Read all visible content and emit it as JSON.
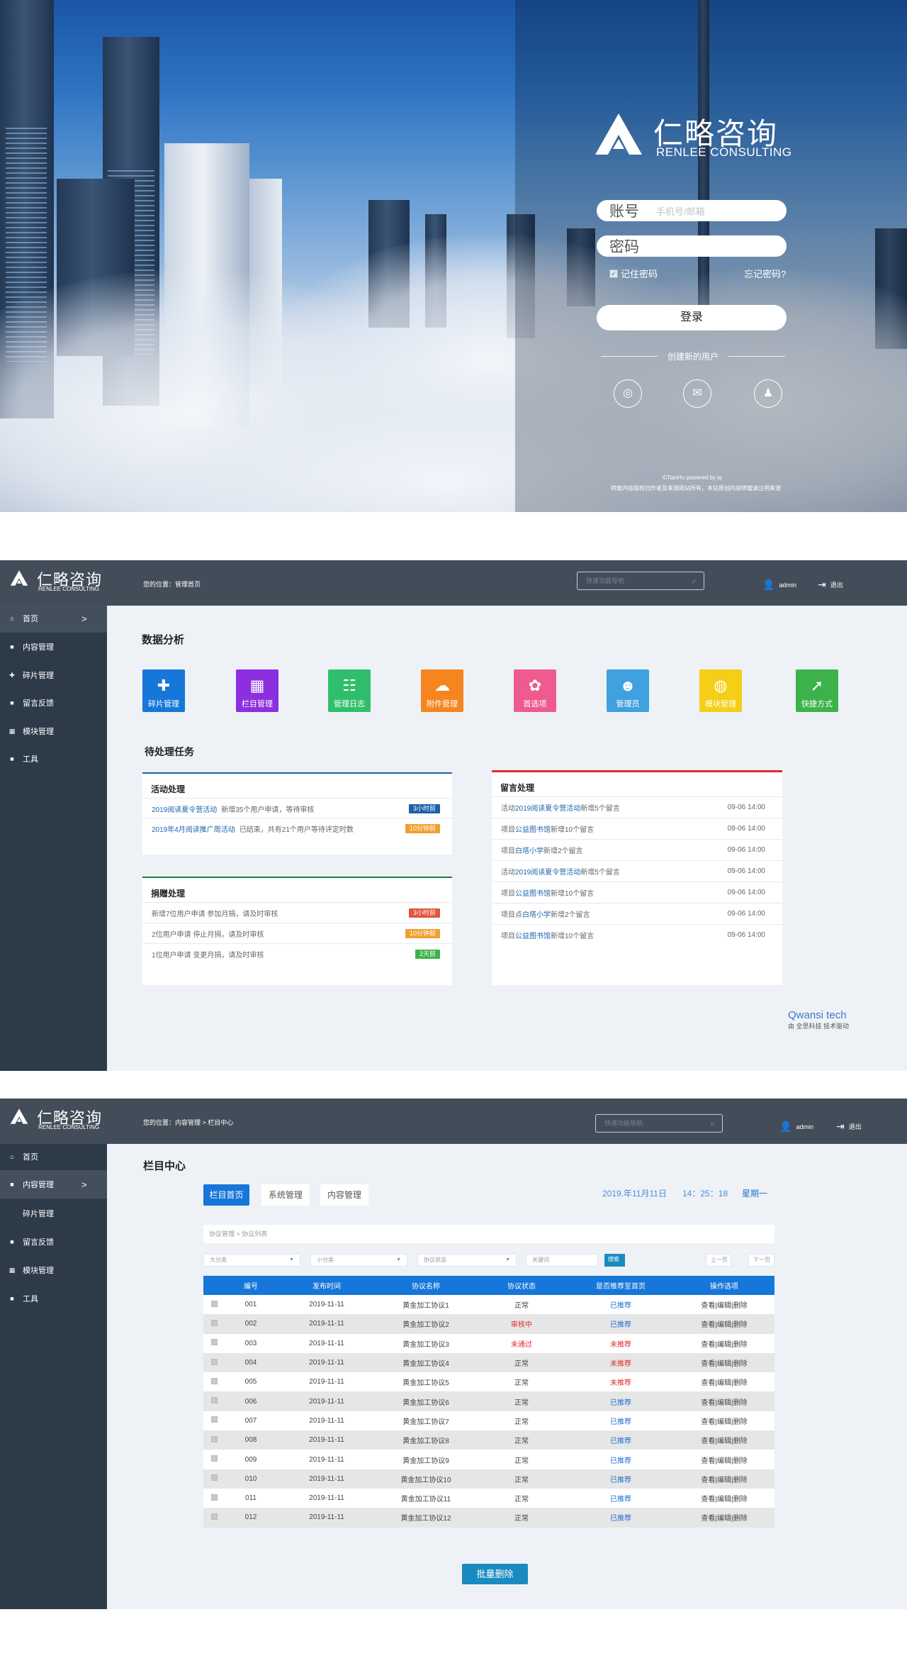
{
  "login": {
    "brand_cn": "仁略咨询",
    "brand_en": "RENLEE CONSULTING",
    "account_label": "账号",
    "account_placeholder": "手机号/邮箱",
    "password_label": "密码",
    "remember": "记住密码",
    "forgot": "忘记密码?",
    "login_button": "登录",
    "create_user": "创建新的用户",
    "social": [
      "weibo-icon",
      "wechat-icon",
      "qq-icon"
    ],
    "footer_line1": "©TianHu powered by jq",
    "footer_line2": "转载内容版权归作者及来源网站所有，本站原创内容转载请注明来源"
  },
  "header": {
    "brand_cn": "仁略咨询",
    "brand_en": "RENLEE CONSULTING",
    "search_placeholder": "快速功能导航",
    "user": "admin",
    "logout": "退出"
  },
  "dashboard": {
    "breadcrumb": "您的位置：管理首页",
    "nav": [
      "首页",
      "内容管理",
      "碎片管理",
      "留言反馈",
      "模块管理",
      "工具"
    ],
    "nav_arrow": ">",
    "analysis_title": "数据分析",
    "tiles": [
      {
        "label": "碎片管理",
        "color": "#1676d9"
      },
      {
        "label": "栏目管理",
        "color": "#8b2fdf"
      },
      {
        "label": "管理日志",
        "color": "#2fbf6c"
      },
      {
        "label": "附件管理",
        "color": "#f5851f"
      },
      {
        "label": "首选项",
        "color": "#ef5a8f"
      },
      {
        "label": "管理员",
        "color": "#3fa1df"
      },
      {
        "label": "模块管理",
        "color": "#f4cf16"
      },
      {
        "label": "快捷方式",
        "color": "#3cb34a"
      }
    ],
    "pending_title": "待处理任务",
    "activity": {
      "title": "活动处理",
      "rows": [
        {
          "a": "2019阅读夏令营活动",
          "b": "新增35个用户申请，等待审核",
          "badge": "3小时前",
          "color": "#1e5fa8"
        },
        {
          "a": "2019年4月阅读推广周活动",
          "b": "已结束，共有21个用户等待评定时数",
          "badge": "10分钟前",
          "color": "#f0a030"
        }
      ]
    },
    "donation": {
      "title": "捐赠处理",
      "rows": [
        {
          "text": "新增7位用户申请 参加月捐，请及时审核",
          "badge": "3小时前",
          "color": "#e0553b"
        },
        {
          "text": "2位用户申请 停止月捐，请及时审核",
          "badge": "10分钟前",
          "color": "#f0a030"
        },
        {
          "text": "1位用户申请 变更月捐，请及时审核",
          "badge": "2天前",
          "color": "#3cb34a"
        }
      ]
    },
    "messages": {
      "title": "留言处理",
      "rows": [
        {
          "pre": "活动",
          "link": "2019阅读夏令营活动",
          "post": "新增5个留言",
          "date": "09-06  14:00"
        },
        {
          "pre": "项目",
          "link": "公益图书馆",
          "post": "新增10个留言",
          "date": "09-06  14:00"
        },
        {
          "pre": "项目",
          "link": "白塔小学",
          "post": "新增2个留言",
          "date": "09-06  14:00"
        },
        {
          "pre": "活动",
          "link": "2019阅读夏令营活动",
          "post": "新增5个留言",
          "date": "09-06  14:00"
        },
        {
          "pre": "项目",
          "link": "公益图书馆",
          "post": "新增10个留言",
          "date": "09-06  14:00"
        },
        {
          "pre": "项目点",
          "link": "白塔小学",
          "post": "新增2个留言",
          "date": "09-06  14:00"
        },
        {
          "pre": "项目",
          "link": "公益图书馆",
          "post": "新增10个留言",
          "date": "09-06  14:00"
        }
      ]
    },
    "credit_1": "Qwansi tech",
    "credit_2": "由 全思科技 技术驱动"
  },
  "column_center": {
    "breadcrumb": "您的位置：内容管理  >  栏目中心",
    "nav": [
      "首页",
      "内容管理",
      "碎片管理",
      "留言反馈",
      "模块管理",
      "工具"
    ],
    "nav_arrow": ">",
    "title": "栏目中心",
    "tabs": [
      "栏目首页",
      "系统管理",
      "内容管理"
    ],
    "date": "2019.年11月11日",
    "time": "14：25：18",
    "weekday": "星期一",
    "sub_breadcrumb": "协议管理  >  协议列表",
    "filters": [
      "大分类",
      "小分类",
      "协议状态"
    ],
    "keyword_placeholder": "关键词",
    "search_button": "搜索",
    "prev": "上一页",
    "next": "下一页",
    "columns": [
      "编号",
      "发布时间",
      "协议名称",
      "协议状态",
      "是否推荐至首页",
      "操作选项"
    ],
    "rows": [
      [
        "001",
        "2019-11-11",
        "黄金加工协议1",
        "正常",
        "已推荐",
        "查看|编辑|删除"
      ],
      [
        "002",
        "2019-11-11",
        "黄金加工协议2",
        "审核中",
        "已推荐",
        "查看|编辑|删除"
      ],
      [
        "003",
        "2019-11-11",
        "黄金加工协议3",
        "未通过",
        "未推荐",
        "查看|编辑|删除"
      ],
      [
        "004",
        "2019-11-11",
        "黄金加工协议4",
        "正常",
        "未推荐",
        "查看|编辑|删除"
      ],
      [
        "005",
        "2019-11-11",
        "黄金加工协议5",
        "正常",
        "未推荐",
        "查看|编辑|删除"
      ],
      [
        "006",
        "2019-11-11",
        "黄金加工协议6",
        "正常",
        "已推荐",
        "查看|编辑|删除"
      ],
      [
        "007",
        "2019-11-11",
        "黄金加工协议7",
        "正常",
        "已推荐",
        "查看|编辑|删除"
      ],
      [
        "008",
        "2019-11-11",
        "黄金加工协议8",
        "正常",
        "已推荐",
        "查看|编辑|删除"
      ],
      [
        "009",
        "2019-11-11",
        "黄金加工协议9",
        "正常",
        "已推荐",
        "查看|编辑|删除"
      ],
      [
        "010",
        "2019-11-11",
        "黄金加工协议10",
        "正常",
        "已推荐",
        "查看|编辑|删除"
      ],
      [
        "011",
        "2019-11-11",
        "黄金加工协议11",
        "正常",
        "已推荐",
        "查看|编辑|删除"
      ],
      [
        "012",
        "2019-11-11",
        "黄金加工协议12",
        "正常",
        "已推荐",
        "查看|编辑|删除"
      ]
    ],
    "bulk_delete": "批量删除"
  }
}
